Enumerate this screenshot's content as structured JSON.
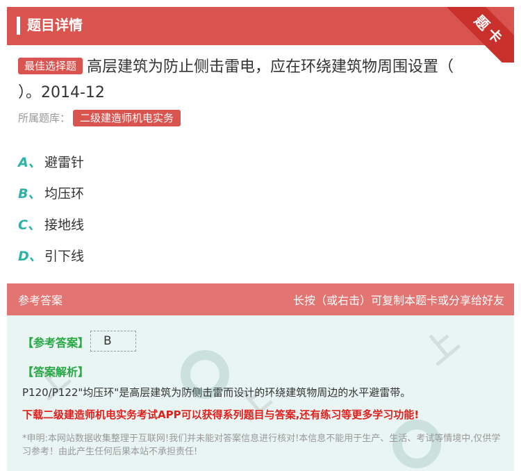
{
  "header": {
    "title": "题目详情",
    "corner_label": "题卡"
  },
  "question": {
    "badge": "最佳选择题",
    "line1": "高层建筑为防止侧击雷电，应在环绕建筑物周围设置（",
    "line2": "）。2014-12"
  },
  "bank": {
    "label": "所属题库：",
    "tag": "二级建造师机电实务"
  },
  "options": [
    {
      "letter": "A、",
      "text": "避雷针"
    },
    {
      "letter": "B、",
      "text": "均压环"
    },
    {
      "letter": "C、",
      "text": "接地线"
    },
    {
      "letter": "D、",
      "text": "引下线"
    }
  ],
  "answer_section": {
    "title": "参考答案",
    "hint": "长按（或右击）可复制本题卡或分享给好友",
    "ref_label": "【参考答案】",
    "ref_value": "B",
    "analysis_label": "【答案解析】",
    "analysis_text": "P120/P122\"均压环\"是高层建筑为防侧击雷而设计的环绕建筑物周边的水平避雷带。",
    "promo": "下载二级建造师机电实务考试APP可以获得系列题目与答案,还有练习等更多学习功能!",
    "disclaimer": "*申明:本网站数据收集整理于互联网!我们并未能对答案信息进行核对!本信息不能用于生产、生活、考试等情境中,仅供学习参考！由此产生任何后果本站不承担责任!"
  },
  "colors": {
    "accent": "#d9534f",
    "option_letter": "#2ab3a6",
    "answer_green": "#27a844",
    "promo_red": "#e0201c"
  }
}
